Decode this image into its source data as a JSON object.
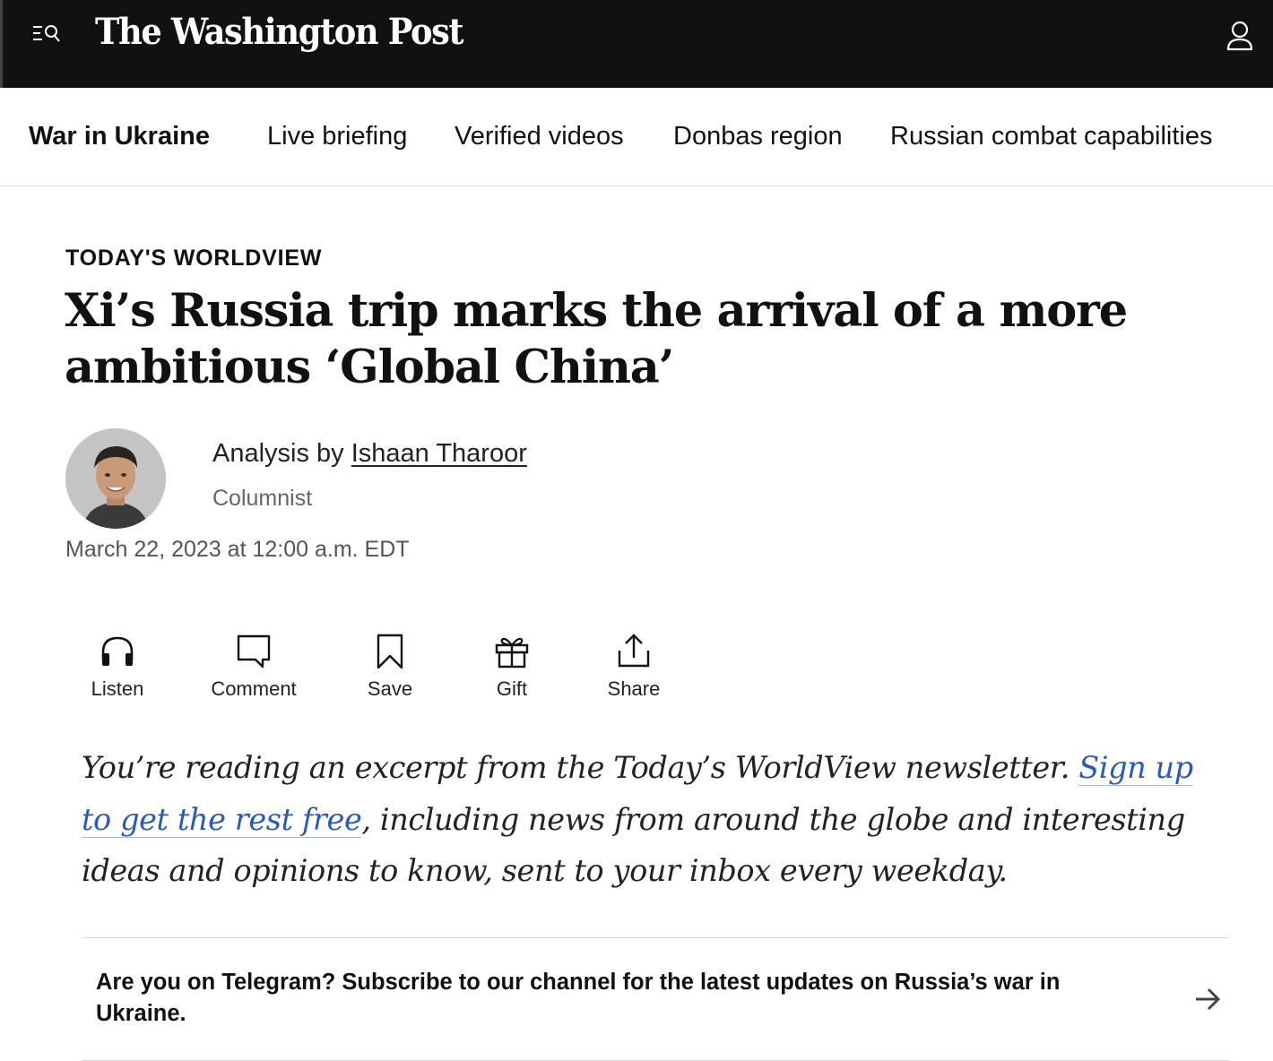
{
  "header": {
    "logo": "The Washington Post",
    "menu_icon": "menu-search-icon",
    "account_icon": "user-icon"
  },
  "subnav": {
    "section": "War in Ukraine",
    "links": [
      "Live briefing",
      "Verified videos",
      "Donbas region",
      "Russian combat capabilities"
    ]
  },
  "article": {
    "kicker": "TODAY'S WORLDVIEW",
    "headline": "Xi’s Russia trip marks the arrival of a more ambitious ‘Global China’",
    "byline_prefix": "Analysis by ",
    "author": "Ishaan Tharoor",
    "author_role": "Columnist",
    "date": "March 22, 2023 at 12:00 a.m. EDT"
  },
  "actions": [
    {
      "label": "Listen",
      "icon": "headphones-icon"
    },
    {
      "label": "Comment",
      "icon": "comment-icon"
    },
    {
      "label": "Save",
      "icon": "bookmark-icon"
    },
    {
      "label": "Gift",
      "icon": "gift-icon"
    },
    {
      "label": "Share",
      "icon": "share-icon"
    }
  ],
  "promo": {
    "before": "You’re reading an excerpt from the Today’s WorldView newsletter. ",
    "link": "Sign up to get the rest free",
    "after": ", including news from around the globe and interesting ideas and opinions to know, sent to your inbox every weekday."
  },
  "callout": {
    "text": "Are you on Telegram? Subscribe to our channel for the latest updates on Russia’s war in Ukraine.",
    "icon": "arrow-right-icon"
  },
  "colors": {
    "topbar": "#111111",
    "link": "#2a5ab3"
  }
}
